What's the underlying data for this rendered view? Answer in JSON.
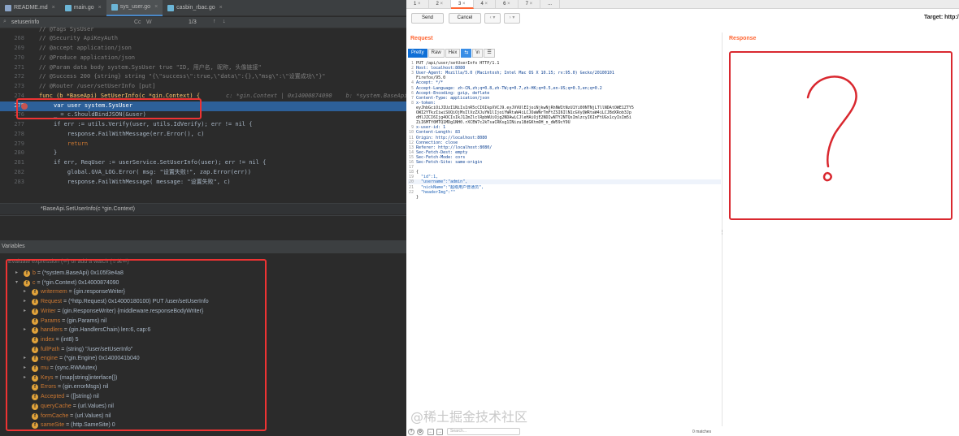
{
  "ide": {
    "tabs": [
      {
        "label": "README.md",
        "icon": "markdown-file-icon"
      },
      {
        "label": "main.go",
        "icon": "go-file-icon"
      },
      {
        "label": "sys_user.go",
        "icon": "go-file-icon"
      },
      {
        "label": "casbin_rbac.go",
        "icon": "go-file-icon"
      }
    ],
    "find": {
      "value": "setuserinfo",
      "count": "1/3",
      "cc": "Cc",
      "w": "W"
    },
    "code_lines": [
      {
        "num": "",
        "text": "// @Tags SysUser",
        "kind": "cmt"
      },
      {
        "num": "268",
        "text": "// @Security ApiKeyAuth",
        "kind": "cmt"
      },
      {
        "num": "269",
        "text": "// @accept application/json",
        "kind": "cmt"
      },
      {
        "num": "270",
        "text": "// @Produce application/json",
        "kind": "cmt"
      },
      {
        "num": "271",
        "text": "// @Param data body system.SysUser true \"ID, 用户名, 昵称, 头像链接\"",
        "kind": "cmt"
      },
      {
        "num": "272",
        "text": "// @Success 200 {string} string \"{\\\"success\\\":true,\\\"data\\\":{},\\\"msg\\\":\\\"设置成功\\\"}\"",
        "kind": "cmt"
      },
      {
        "num": "273",
        "text": "// @Router /user/setUserInfo [put]",
        "kind": "cmt"
      },
      {
        "num": "274",
        "text": "func (b *BaseApi) SetUserInfo(c *gin.Context) {",
        "hint": "c: *gin.Context | 0x14000874090    b: *system.BaseApi",
        "kind": "func"
      },
      {
        "num": "275",
        "text": "var user system.SysUser",
        "kind": "current"
      },
      {
        "num": "276",
        "text": "_ = c.ShouldBindJSON(&user)",
        "kind": "code"
      },
      {
        "num": "277",
        "text": "if err := utils.Verify(user, utils.IdVerify); err != nil {",
        "kind": "code"
      },
      {
        "num": "278",
        "text": "    response.FailWithMessage(err.Error(), c)",
        "kind": "code"
      },
      {
        "num": "279",
        "text": "    return",
        "kind": "code"
      },
      {
        "num": "280",
        "text": "}",
        "kind": "code"
      },
      {
        "num": "281",
        "text": "if err, ReqUser := userService.SetUserInfo(user); err != nil {",
        "kind": "code"
      },
      {
        "num": "282",
        "text": "    global.GVA_LOG.Error( msg: \"设置失败!\", zap.Error(err))",
        "kind": "code"
      },
      {
        "num": "283",
        "text": "    response.FailWithMessage( message: \"设置失败\", c)",
        "kind": "code"
      }
    ],
    "breadcrumb": "*BaseApi.SetUserInfo(c *gin.Context)",
    "variables_label": "Variables",
    "watch_placeholder": "Evaluate expression (⏎) or add a watch (⇧⌘⏎)",
    "variables": [
      {
        "tw": "▸",
        "name": "b",
        "value": "(*system.BaseApi) 0x105f3e4a8"
      },
      {
        "tw": "▾",
        "name": "c",
        "value": "(*gin.Context) 0x14000874090"
      },
      {
        "tw": "▸",
        "name": "writermem",
        "value": "{gin.responseWriter}",
        "indent": true
      },
      {
        "tw": "▸",
        "name": "Request",
        "value": "(*http.Request) 0x14000180100) PUT /user/setUserInfo",
        "indent": true
      },
      {
        "tw": "▸",
        "name": "Writer",
        "value": "(gin.ResponseWriter) {middleware.responseBodyWriter}",
        "indent": true
      },
      {
        "tw": "",
        "name": "Params",
        "value": "(gin.Params) nil",
        "indent": true
      },
      {
        "tw": "▸",
        "name": "handlers",
        "value": "(gin.HandlersChain) len:6, cap:6",
        "indent": true
      },
      {
        "tw": "",
        "name": "index",
        "value": "(int8) 5",
        "indent": true
      },
      {
        "tw": "",
        "name": "fullPath",
        "value": "(string) \"/user/setUserInfo\"",
        "indent": true
      },
      {
        "tw": "▸",
        "name": "engine",
        "value": "(*gin.Engine) 0x1400041b040",
        "indent": true
      },
      {
        "tw": "▸",
        "name": "mu",
        "value": "(sync.RWMutex)",
        "indent": true
      },
      {
        "tw": "▸",
        "name": "Keys",
        "value": "(map[string]interface{})",
        "indent": true
      },
      {
        "tw": "",
        "name": "Errors",
        "value": "(gin.errorMsgs) nil",
        "indent": true
      },
      {
        "tw": "",
        "name": "Accepted",
        "value": "([]string) nil",
        "indent": true
      },
      {
        "tw": "",
        "name": "queryCache",
        "value": "(url.Values) nil",
        "indent": true
      },
      {
        "tw": "",
        "name": "formCache",
        "value": "(url.Values) nil",
        "indent": true
      },
      {
        "tw": "",
        "name": "sameSite",
        "value": "(http.SameSite) 0",
        "indent": true
      }
    ]
  },
  "burp": {
    "tabs": [
      "1",
      "2",
      "3",
      "4",
      "6",
      "7",
      "..."
    ],
    "active_tab": "3",
    "send_label": "Send",
    "cancel_label": "Cancel",
    "target_label": "Target: http:/",
    "request_title": "Request",
    "response_title": "Response",
    "view_buttons": [
      "Pretty",
      "Raw",
      "Hex"
    ],
    "request_lines": [
      "PUT /api/user/setUserInfo HTTP/1.1",
      "Host: localhost:8080",
      "User-Agent: Mozilla/5.0 (Macintosh; Intel Mac OS X 10.15; rv:95.0) Gecko/20100101",
      "Firefox/95.0",
      "Accept: */*",
      "Accept-Language: zh-CN,zh;q=0.8,zh-TW;q=0.7,zh-HK;q=0.5,en-US;q=0.3,en;q=0.2",
      "Accept-Encoding: gzip, deflate",
      "Content-Type: application/json",
      "x-token:",
      "eyJhbGciOiJIUzI1NiIsInR5cCI6IkpXVCJ9.eyJVVUlEIjoiNjkwNjRhNWItNzU1Yi00NTNjLTllNDAtOWE1ZTY5",
      "OWI2YTkzIiwiSUQiOjMsIlVzZXJuYW1lIjoiYWRtaW4iLCJOaWNrTmFtZSI6IlN1cGVyQWRtaW4iLCJBdXRob3Jp",
      "dHlJZCI6Ijg4OCIsIkJ1ZmZlclRpbWUiOjg2NDAwLCJleHAiOjE2NDIwNTY2NTQsImlzcyI6InFtUGx1cyIsIm5i",
      "ZiI6MTY0MTQ1MDg1NH0.rXCEW7c2kTsaCRKsg1INizu18dGKtmOH_n_dW59cY9U",
      "x-user-id: 1",
      "Content-Length: 83",
      "Origin: http://localhost:8080",
      "Connection: close",
      "Referer: http://localhost:8080/",
      "Sec-Fetch-Dest: empty",
      "Sec-Fetch-Mode: cors",
      "Sec-Fetch-Site: same-origin",
      "",
      "{",
      "  \"id\":1,",
      "  \"username\":\"admin\",",
      "  \"nickName\":\"超级用户普通员\",",
      "  \"headerImg\":\"\"",
      "}"
    ],
    "request_line_numbers": [
      "1",
      "2",
      "3",
      "",
      "4",
      "5",
      "6",
      "7",
      "8",
      "",
      "",
      "",
      "",
      "9",
      "10",
      "11",
      "12",
      "13",
      "14",
      "15",
      "16",
      "17",
      "18",
      "19",
      "20",
      "21",
      "22",
      ""
    ],
    "search_placeholder": "Search...",
    "matches": "0 matches",
    "response_annotation": "?"
  },
  "watermark": "@稀土掘金技术社区"
}
